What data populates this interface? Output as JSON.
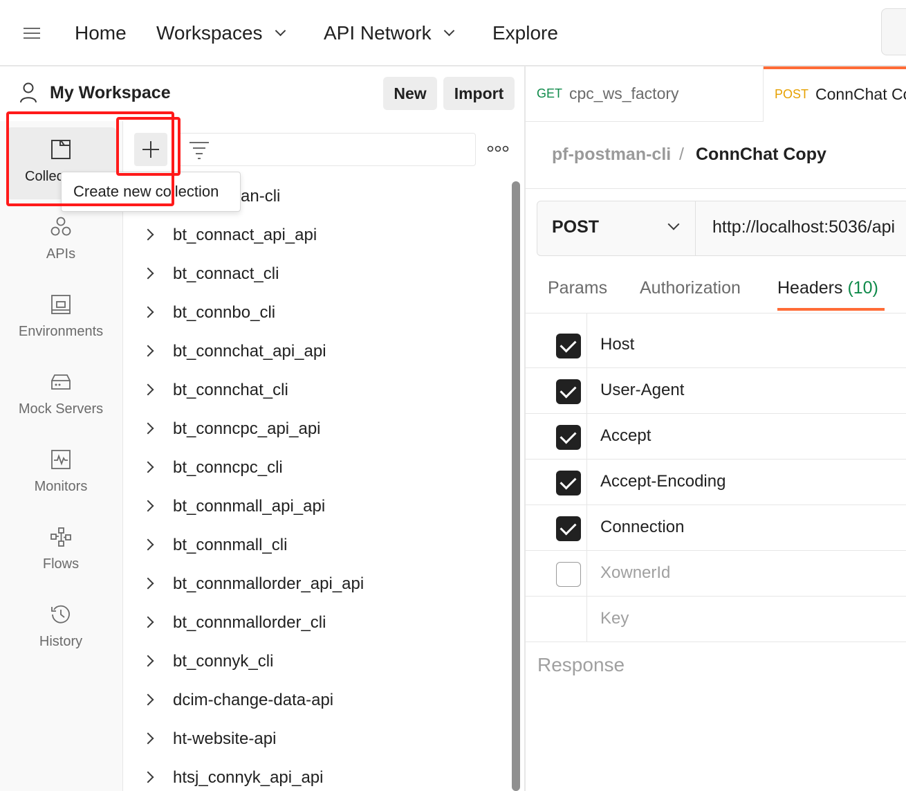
{
  "nav": {
    "items": [
      {
        "label": "Home",
        "dropdown": false
      },
      {
        "label": "Workspaces",
        "dropdown": true
      },
      {
        "label": "API Network",
        "dropdown": true
      },
      {
        "label": "Explore",
        "dropdown": false
      }
    ]
  },
  "workspace": {
    "title": "My Workspace",
    "new_label": "New",
    "import_label": "Import"
  },
  "rail": {
    "items": [
      {
        "label": "Collec",
        "icon": "collections-icon",
        "active": true
      },
      {
        "label": "APIs",
        "icon": "apis-icon"
      },
      {
        "label": "Environments",
        "icon": "environments-icon"
      },
      {
        "label": "Mock Servers",
        "icon": "mock-servers-icon"
      },
      {
        "label": "Monitors",
        "icon": "monitors-icon"
      },
      {
        "label": "Flows",
        "icon": "flows-icon"
      },
      {
        "label": "History",
        "icon": "history-icon"
      }
    ]
  },
  "tooltip": {
    "text": "Create new collection"
  },
  "collections": {
    "partial_first": "an-cli",
    "items": [
      "bt_connact_api_api",
      "bt_connact_cli",
      "bt_connbo_cli",
      "bt_connchat_api_api",
      "bt_connchat_cli",
      "bt_conncpc_api_api",
      "bt_conncpc_cli",
      "bt_connmall_api_api",
      "bt_connmall_cli",
      "bt_connmallorder_api_api",
      "bt_connmallorder_cli",
      "bt_connyk_cli",
      "dcim-change-data-api",
      "ht-website-api",
      "htsj_connyk_api_api"
    ]
  },
  "tabs": [
    {
      "method": "GET",
      "name": "cpc_ws_factory",
      "method_color": "#0f8a4a",
      "active": false
    },
    {
      "method": "POST",
      "name": "ConnChat Co",
      "method_color": "#e6a000",
      "active": true
    }
  ],
  "breadcrumb": {
    "parent": "pf-postman-cli",
    "separator": "/",
    "current": "ConnChat Copy"
  },
  "request": {
    "method": "POST",
    "url": "http://localhost:5036/api"
  },
  "subtabs": {
    "params": "Params",
    "authorization": "Authorization",
    "headers": "Headers",
    "headers_count": "(10)"
  },
  "headers": [
    {
      "key": "Host",
      "checked": true
    },
    {
      "key": "User-Agent",
      "checked": true
    },
    {
      "key": "Accept",
      "checked": true
    },
    {
      "key": "Accept-Encoding",
      "checked": true
    },
    {
      "key": "Connection",
      "checked": true
    },
    {
      "key": "XownerId",
      "checked": false
    }
  ],
  "headers_placeholder": "Key",
  "response": {
    "label": "Response"
  },
  "colors": {
    "accent": "#ff6c37",
    "highlight": "#ff1a1a",
    "get": "#0f8a4a",
    "post": "#e6a000"
  }
}
